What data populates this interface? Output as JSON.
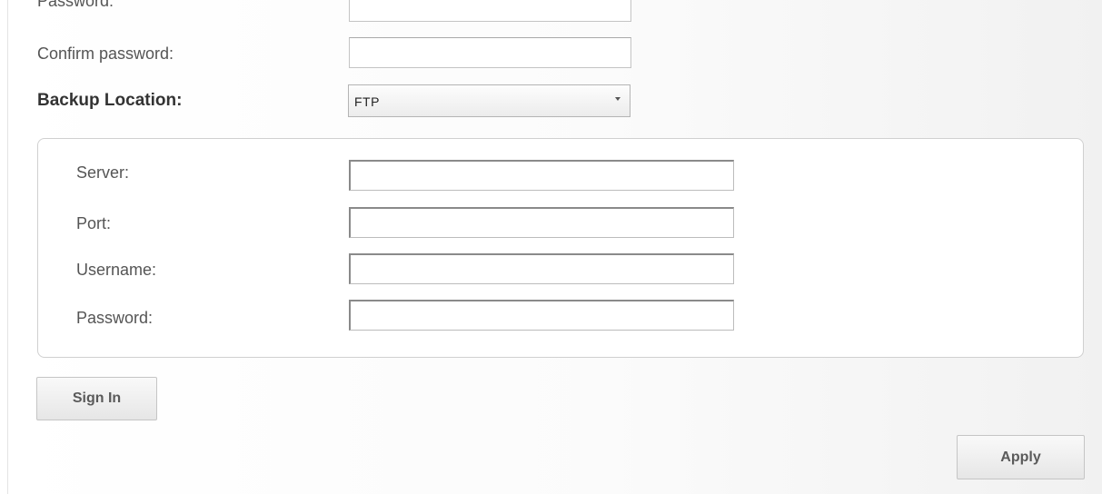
{
  "form": {
    "password_label": "Password:",
    "confirm_password_label": "Confirm password:",
    "confirm_password_value": "",
    "backup_location_label": "Backup Location:",
    "backup_location_value": "FTP"
  },
  "ftp": {
    "server_label": "Server:",
    "server_value": "",
    "port_label": "Port:",
    "port_value": "",
    "username_label": "Username:",
    "username_value": "",
    "password_label": "Password:",
    "password_value": ""
  },
  "buttons": {
    "sign_in": "Sign In",
    "apply": "Apply"
  },
  "icons": {
    "dropdown": "chevron-down-icon"
  }
}
